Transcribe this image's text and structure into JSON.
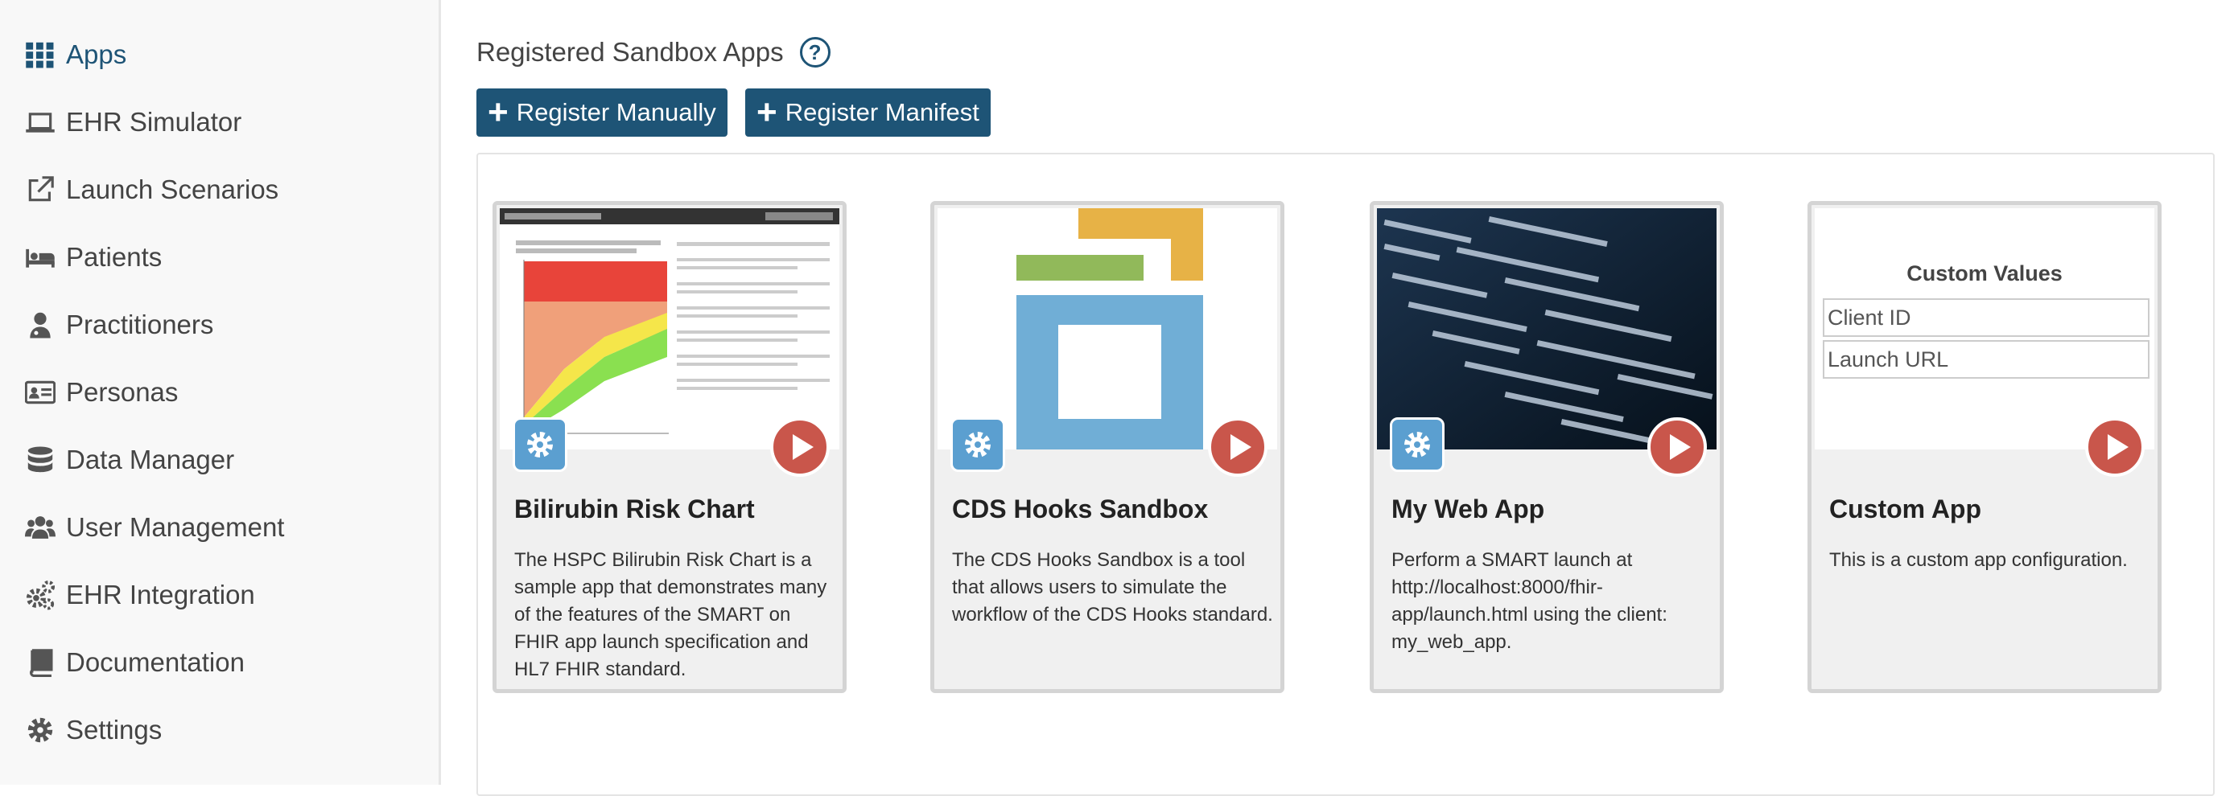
{
  "sidebar": {
    "items": [
      {
        "label": "Apps",
        "icon": "grid-icon",
        "active": true
      },
      {
        "label": "EHR Simulator",
        "icon": "laptop-icon"
      },
      {
        "label": "Launch Scenarios",
        "icon": "external-link-icon"
      },
      {
        "label": "Patients",
        "icon": "bed-icon"
      },
      {
        "label": "Practitioners",
        "icon": "doctor-icon"
      },
      {
        "label": "Personas",
        "icon": "id-card-icon"
      },
      {
        "label": "Data Manager",
        "icon": "database-icon"
      },
      {
        "label": "User Management",
        "icon": "users-icon"
      },
      {
        "label": "EHR Integration",
        "icon": "gears-icon"
      },
      {
        "label": "Documentation",
        "icon": "book-icon"
      },
      {
        "label": "Settings",
        "icon": "gear-icon"
      }
    ]
  },
  "main": {
    "heading": "Registered Sandbox Apps",
    "help_icon": "question-circle-icon",
    "register_manually": "Register Manually",
    "register_manifest": "Register Manifest"
  },
  "apps": [
    {
      "title": "Bilirubin Risk Chart",
      "description": "The HSPC Bilirubin Risk Chart is a sample app that demonstrates many of the features of the SMART on FHIR app launch specification and HL7 FHIR standard."
    },
    {
      "title": "CDS Hooks Sandbox",
      "description": "The CDS Hooks Sandbox is a tool that allows users to simulate the workflow of the CDS Hooks standard."
    },
    {
      "title": "My Web App",
      "description": "Perform a SMART launch at http://localhost:8000/fhir-app/launch.html using the client: my_web_app."
    },
    {
      "title": "Custom App",
      "description": "This is a custom app configuration.",
      "custom_values_title": "Custom Values",
      "client_id_placeholder": "Client ID",
      "launch_url_placeholder": "Launch URL"
    }
  ],
  "colors": {
    "primary": "#1e5476",
    "play": "#c9564b",
    "gear_badge": "#5b9fd0"
  }
}
